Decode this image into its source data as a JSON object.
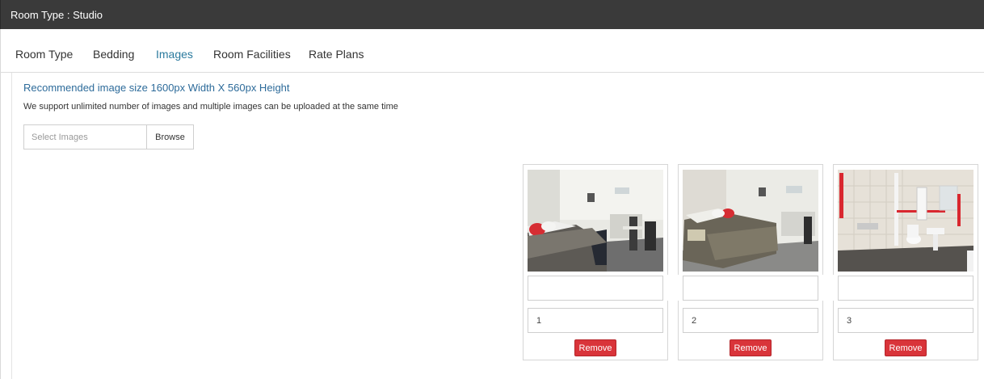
{
  "window": {
    "title": "Room Type : Studio"
  },
  "tabs": [
    {
      "label": "Room Type",
      "active": false
    },
    {
      "label": "Bedding",
      "active": false
    },
    {
      "label": "Images",
      "active": true
    },
    {
      "label": "Room Facilities",
      "active": false
    },
    {
      "label": "Rate Plans",
      "active": false
    }
  ],
  "upload": {
    "recommendation": "Recommended image size 1600px Width X 560px Height",
    "support_note": "We support unlimited number of images and multiple images can be uploaded at the same time",
    "placeholder": "Select Images",
    "browse_label": "Browse"
  },
  "images": [
    {
      "caption": "",
      "order": "1",
      "remove_label": "Remove"
    },
    {
      "caption": "",
      "order": "2",
      "remove_label": "Remove"
    },
    {
      "caption": "",
      "order": "3",
      "remove_label": "Remove"
    }
  ],
  "colors": {
    "titlebar": "#3a3a3a",
    "active_tab": "#2a7a9e",
    "link_text": "#2d6b9a",
    "remove_button": "#d9343a"
  }
}
